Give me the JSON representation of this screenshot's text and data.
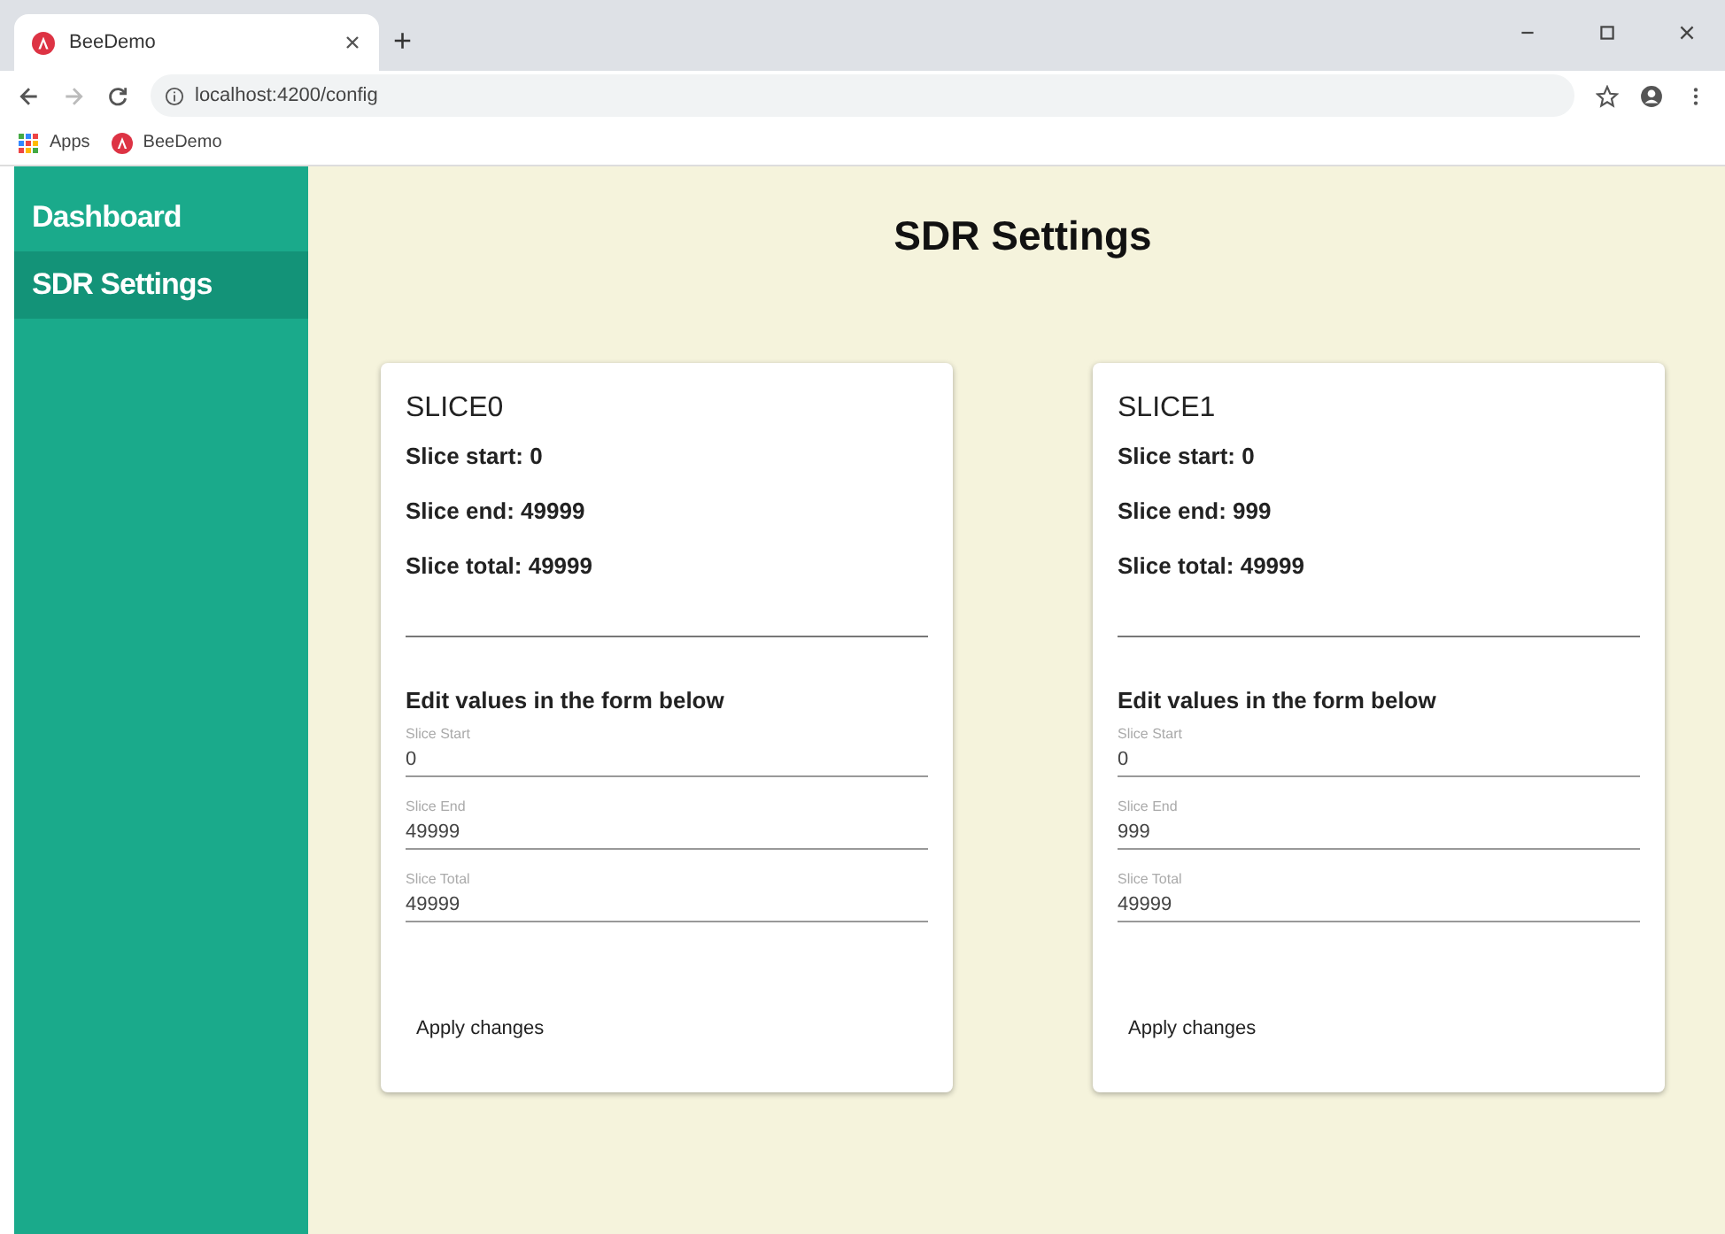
{
  "browser": {
    "tab_title": "BeeDemo",
    "new_tab": "+",
    "address": "localhost:4200/config",
    "bookmarks": [
      {
        "label": "Apps",
        "kind": "apps"
      },
      {
        "label": "BeeDemo",
        "kind": "site"
      }
    ]
  },
  "sidebar": {
    "items": [
      {
        "label": "Dashboard",
        "selected": false
      },
      {
        "label": "SDR Settings",
        "selected": true
      }
    ]
  },
  "page_title": "SDR Settings",
  "cards": [
    {
      "title": "SLICE0",
      "facts": [
        "Slice start: 0",
        "Slice end: 49999",
        "Slice total: 49999"
      ],
      "form_heading": "Edit values in the form below",
      "fields": [
        {
          "label": "Slice Start",
          "value": "0"
        },
        {
          "label": "Slice End",
          "value": "49999"
        },
        {
          "label": "Slice Total",
          "value": "49999"
        }
      ],
      "button": "Apply changes"
    },
    {
      "title": "SLICE1",
      "facts": [
        "Slice start: 0",
        "Slice end: 999",
        "Slice total: 49999"
      ],
      "form_heading": "Edit values in the form below",
      "fields": [
        {
          "label": "Slice Start",
          "value": "0"
        },
        {
          "label": "Slice End",
          "value": "999"
        },
        {
          "label": "Slice Total",
          "value": "49999"
        }
      ],
      "button": "Apply changes"
    }
  ]
}
